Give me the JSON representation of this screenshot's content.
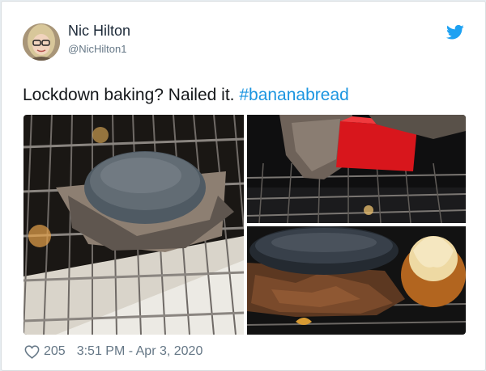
{
  "tweet": {
    "author_name": "Nic Hilton",
    "author_handle": "@NicHilton1",
    "text_prefix": "Lockdown baking? Nailed it. ",
    "hashtag": "#bananabread",
    "likes": "205",
    "timestamp": "3:51 PM - Apr 3, 2020"
  },
  "icons": {
    "brand": "twitter-bird-icon",
    "like": "heart-icon"
  },
  "colors": {
    "brand_blue": "#1da1f2",
    "link_blue": "#1b95e0",
    "muted": "#657786",
    "text": "#14171a"
  }
}
